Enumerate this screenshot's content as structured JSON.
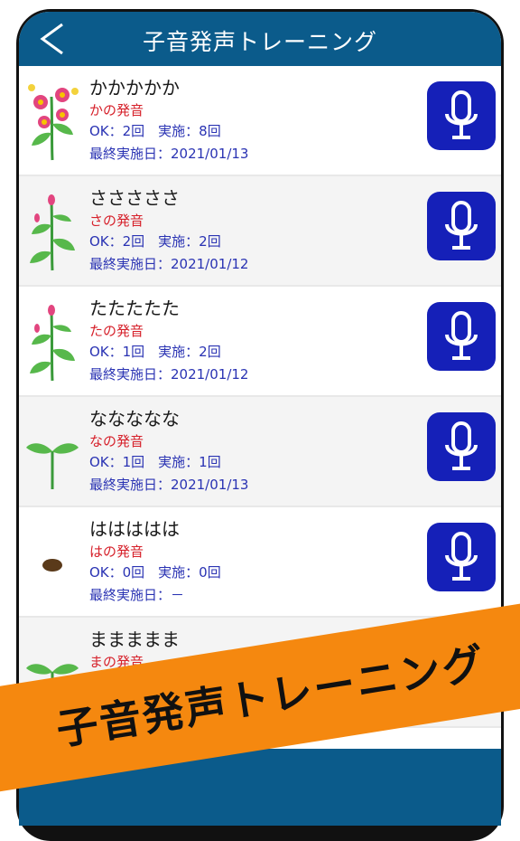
{
  "header": {
    "title": "子音発声トレーニング"
  },
  "rows": [
    {
      "name": "かかかかか",
      "sound": "かの発音",
      "stats": "OK：2回　実施：8回",
      "last": "最終実施日：2021/01/13",
      "plant": "flower-plant-icon"
    },
    {
      "name": "さささささ",
      "sound": "さの発音",
      "stats": "OK：2回　実施：2回",
      "last": "最終実施日：2021/01/12",
      "plant": "budding-plant-icon"
    },
    {
      "name": "たたたたた",
      "sound": "たの発音",
      "stats": "OK：1回　実施：2回",
      "last": "最終実施日：2021/01/12",
      "plant": "budding-plant-icon"
    },
    {
      "name": "ななななな",
      "sound": "なの発音",
      "stats": "OK：1回　実施：1回",
      "last": "最終実施日：2021/01/13",
      "plant": "sprout-icon"
    },
    {
      "name": "ははははは",
      "sound": "はの発音",
      "stats": "OK：0回　実施：0回",
      "last": "最終実施日：－",
      "plant": "seed-icon"
    },
    {
      "name": "ままままま",
      "sound": "まの発音",
      "stats": "",
      "last": "",
      "plant": "sprout-icon"
    }
  ],
  "banner": {
    "text": "子音発声トレーニング"
  },
  "colors": {
    "header": "#0b5b8b",
    "mic": "#1520b8",
    "sound": "#d6202a",
    "stats": "#2a33b3",
    "banner": "#f5880f"
  }
}
